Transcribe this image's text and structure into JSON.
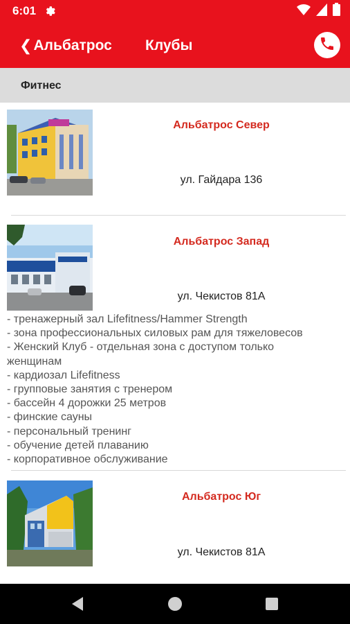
{
  "status_bar": {
    "time": "6:01",
    "icons": [
      "settings-gear-icon",
      "wifi-icon",
      "signal-icon",
      "battery-icon"
    ]
  },
  "app_bar": {
    "back_label": "Альбатрос",
    "title": "Клубы",
    "call_icon": "phone-icon",
    "color": "#e8121d"
  },
  "section": {
    "title": "Фитнес"
  },
  "clubs": [
    {
      "name": "Альбатрос Север",
      "address": "ул. Гайдара 136",
      "photo": "building-photo-yellow-blue"
    },
    {
      "name": "Альбатрос Запад",
      "address": "ул. Чекистов 81А",
      "photo": "building-photo-blue-white",
      "features": [
        "- тренажерный зал Lifefitness/Hammer Strength",
        "- зона профессиональных силовых рам для тяжеловесов",
        "- Женский Клуб - отдельная зона с доступом только",
        "женщинам",
        "- кардиозал Lifefitness",
        "- групповые занятия с тренером",
        "- бассейн 4 дорожки 25 метров",
        "- финские сауны",
        "- персональный тренинг",
        "- обучение детей плаванию",
        "- корпоративное обслуживание"
      ]
    },
    {
      "name": "Альбатрос Юг",
      "address": "ул. Чекистов 81А",
      "photo": "building-photo-yellow-blue-trees"
    }
  ],
  "nav_bar": {
    "icons": [
      "back-triangle-icon",
      "home-circle-icon",
      "recents-square-icon"
    ]
  },
  "colors": {
    "accent": "#e8121d",
    "club_name": "#d42a1f",
    "section_bg": "#dcdcdc"
  }
}
